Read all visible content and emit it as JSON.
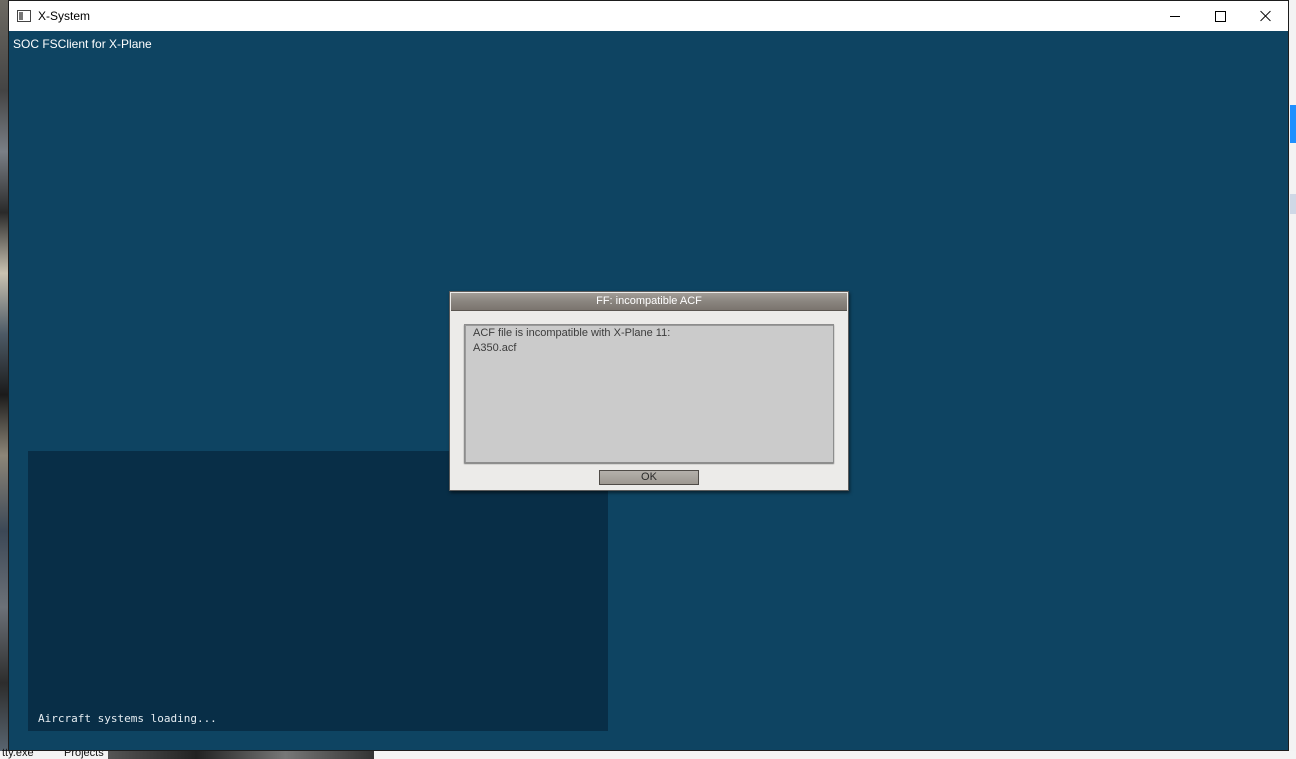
{
  "window": {
    "title": "X-System",
    "controls": {
      "minimize": "minimize",
      "maximize": "maximize",
      "close": "close"
    }
  },
  "client": {
    "plugin_label": "SOC FSClient for X-Plane",
    "log_message": "Aircraft systems loading..."
  },
  "dialog": {
    "title": "FF: incompatible ACF",
    "message_line1": "ACF file is incompatible with X-Plane 11:",
    "message_line2": "A350.acf",
    "ok_label": "OK"
  },
  "desktop": {
    "bottom_labels": [
      "tty.exe",
      "Projects"
    ]
  },
  "colors": {
    "background": "#0e4462",
    "log_panel": "#082e47",
    "dialog_face": "#ecebe9",
    "dialog_title": "#8c8781"
  }
}
